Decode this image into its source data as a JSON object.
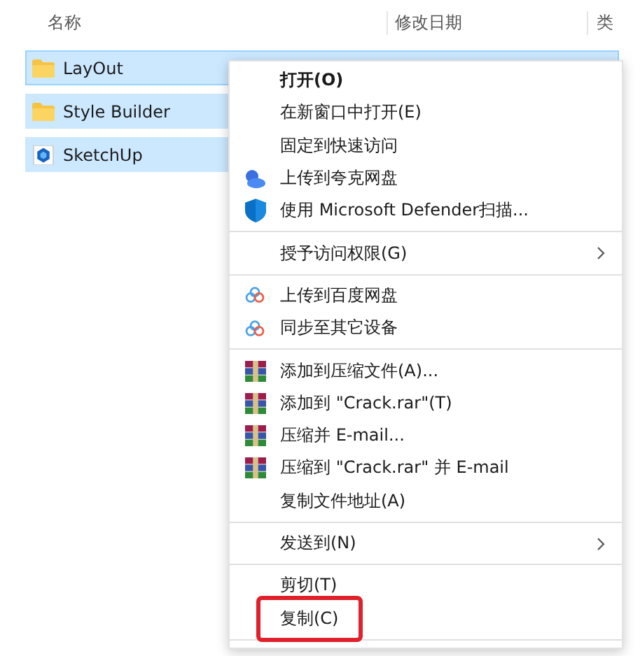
{
  "columns": [
    "名称",
    "修改日期",
    "类"
  ],
  "files": [
    {
      "name": "LayOut",
      "kind": "folder",
      "selected": true
    },
    {
      "name": "Style Builder",
      "kind": "folder",
      "selected": true
    },
    {
      "name": "SketchUp",
      "kind": "app",
      "selected": true
    }
  ],
  "context_menu": [
    {
      "kind": "plain",
      "label": "打开(O)",
      "bold": true
    },
    {
      "kind": "plain",
      "label": "在新窗口中打开(E)"
    },
    {
      "kind": "plain",
      "label": "固定到快速访问"
    },
    {
      "kind": "cloud",
      "label": "上传到夸克网盘"
    },
    {
      "kind": "shield",
      "label": "使用 Microsoft Defender扫描..."
    },
    {
      "kind": "separator"
    },
    {
      "kind": "submenu",
      "label": "授予访问权限(G)"
    },
    {
      "kind": "separator"
    },
    {
      "kind": "baidu",
      "label": "上传到百度网盘"
    },
    {
      "kind": "baidu",
      "label": "同步至其它设备"
    },
    {
      "kind": "separator"
    },
    {
      "kind": "archive",
      "label": "添加到压缩文件(A)..."
    },
    {
      "kind": "archive",
      "label": "添加到 \"Crack.rar\"(T)"
    },
    {
      "kind": "archive",
      "label": "压缩并 E-mail..."
    },
    {
      "kind": "archive",
      "label": "压缩到 \"Crack.rar\" 并 E-mail"
    },
    {
      "kind": "plain",
      "label": "复制文件地址(A)"
    },
    {
      "kind": "separator"
    },
    {
      "kind": "submenu",
      "label": "发送到(N)"
    },
    {
      "kind": "separator"
    },
    {
      "kind": "plain",
      "label": "剪切(T)"
    },
    {
      "kind": "plain",
      "label": "复制(C)",
      "boxed": true
    },
    {
      "kind": "separator"
    }
  ]
}
